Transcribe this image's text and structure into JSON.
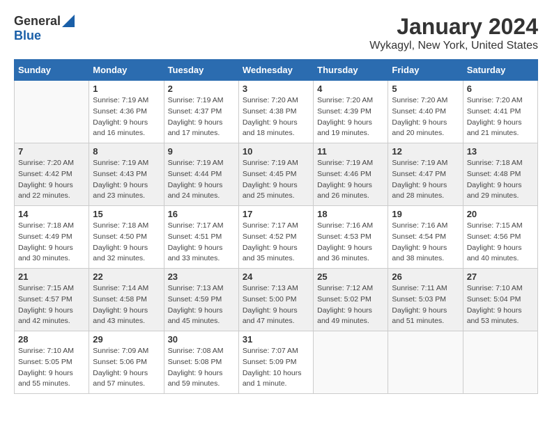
{
  "logo": {
    "general": "General",
    "blue": "Blue"
  },
  "title": "January 2024",
  "subtitle": "Wykagyl, New York, United States",
  "days_header": [
    "Sunday",
    "Monday",
    "Tuesday",
    "Wednesday",
    "Thursday",
    "Friday",
    "Saturday"
  ],
  "weeks": [
    [
      {
        "day": "",
        "info": ""
      },
      {
        "day": "1",
        "info": "Sunrise: 7:19 AM\nSunset: 4:36 PM\nDaylight: 9 hours\nand 16 minutes."
      },
      {
        "day": "2",
        "info": "Sunrise: 7:19 AM\nSunset: 4:37 PM\nDaylight: 9 hours\nand 17 minutes."
      },
      {
        "day": "3",
        "info": "Sunrise: 7:20 AM\nSunset: 4:38 PM\nDaylight: 9 hours\nand 18 minutes."
      },
      {
        "day": "4",
        "info": "Sunrise: 7:20 AM\nSunset: 4:39 PM\nDaylight: 9 hours\nand 19 minutes."
      },
      {
        "day": "5",
        "info": "Sunrise: 7:20 AM\nSunset: 4:40 PM\nDaylight: 9 hours\nand 20 minutes."
      },
      {
        "day": "6",
        "info": "Sunrise: 7:20 AM\nSunset: 4:41 PM\nDaylight: 9 hours\nand 21 minutes."
      }
    ],
    [
      {
        "day": "7",
        "info": "Sunrise: 7:20 AM\nSunset: 4:42 PM\nDaylight: 9 hours\nand 22 minutes."
      },
      {
        "day": "8",
        "info": "Sunrise: 7:19 AM\nSunset: 4:43 PM\nDaylight: 9 hours\nand 23 minutes."
      },
      {
        "day": "9",
        "info": "Sunrise: 7:19 AM\nSunset: 4:44 PM\nDaylight: 9 hours\nand 24 minutes."
      },
      {
        "day": "10",
        "info": "Sunrise: 7:19 AM\nSunset: 4:45 PM\nDaylight: 9 hours\nand 25 minutes."
      },
      {
        "day": "11",
        "info": "Sunrise: 7:19 AM\nSunset: 4:46 PM\nDaylight: 9 hours\nand 26 minutes."
      },
      {
        "day": "12",
        "info": "Sunrise: 7:19 AM\nSunset: 4:47 PM\nDaylight: 9 hours\nand 28 minutes."
      },
      {
        "day": "13",
        "info": "Sunrise: 7:18 AM\nSunset: 4:48 PM\nDaylight: 9 hours\nand 29 minutes."
      }
    ],
    [
      {
        "day": "14",
        "info": "Sunrise: 7:18 AM\nSunset: 4:49 PM\nDaylight: 9 hours\nand 30 minutes."
      },
      {
        "day": "15",
        "info": "Sunrise: 7:18 AM\nSunset: 4:50 PM\nDaylight: 9 hours\nand 32 minutes."
      },
      {
        "day": "16",
        "info": "Sunrise: 7:17 AM\nSunset: 4:51 PM\nDaylight: 9 hours\nand 33 minutes."
      },
      {
        "day": "17",
        "info": "Sunrise: 7:17 AM\nSunset: 4:52 PM\nDaylight: 9 hours\nand 35 minutes."
      },
      {
        "day": "18",
        "info": "Sunrise: 7:16 AM\nSunset: 4:53 PM\nDaylight: 9 hours\nand 36 minutes."
      },
      {
        "day": "19",
        "info": "Sunrise: 7:16 AM\nSunset: 4:54 PM\nDaylight: 9 hours\nand 38 minutes."
      },
      {
        "day": "20",
        "info": "Sunrise: 7:15 AM\nSunset: 4:56 PM\nDaylight: 9 hours\nand 40 minutes."
      }
    ],
    [
      {
        "day": "21",
        "info": "Sunrise: 7:15 AM\nSunset: 4:57 PM\nDaylight: 9 hours\nand 42 minutes."
      },
      {
        "day": "22",
        "info": "Sunrise: 7:14 AM\nSunset: 4:58 PM\nDaylight: 9 hours\nand 43 minutes."
      },
      {
        "day": "23",
        "info": "Sunrise: 7:13 AM\nSunset: 4:59 PM\nDaylight: 9 hours\nand 45 minutes."
      },
      {
        "day": "24",
        "info": "Sunrise: 7:13 AM\nSunset: 5:00 PM\nDaylight: 9 hours\nand 47 minutes."
      },
      {
        "day": "25",
        "info": "Sunrise: 7:12 AM\nSunset: 5:02 PM\nDaylight: 9 hours\nand 49 minutes."
      },
      {
        "day": "26",
        "info": "Sunrise: 7:11 AM\nSunset: 5:03 PM\nDaylight: 9 hours\nand 51 minutes."
      },
      {
        "day": "27",
        "info": "Sunrise: 7:10 AM\nSunset: 5:04 PM\nDaylight: 9 hours\nand 53 minutes."
      }
    ],
    [
      {
        "day": "28",
        "info": "Sunrise: 7:10 AM\nSunset: 5:05 PM\nDaylight: 9 hours\nand 55 minutes."
      },
      {
        "day": "29",
        "info": "Sunrise: 7:09 AM\nSunset: 5:06 PM\nDaylight: 9 hours\nand 57 minutes."
      },
      {
        "day": "30",
        "info": "Sunrise: 7:08 AM\nSunset: 5:08 PM\nDaylight: 9 hours\nand 59 minutes."
      },
      {
        "day": "31",
        "info": "Sunrise: 7:07 AM\nSunset: 5:09 PM\nDaylight: 10 hours\nand 1 minute."
      },
      {
        "day": "",
        "info": ""
      },
      {
        "day": "",
        "info": ""
      },
      {
        "day": "",
        "info": ""
      }
    ]
  ]
}
